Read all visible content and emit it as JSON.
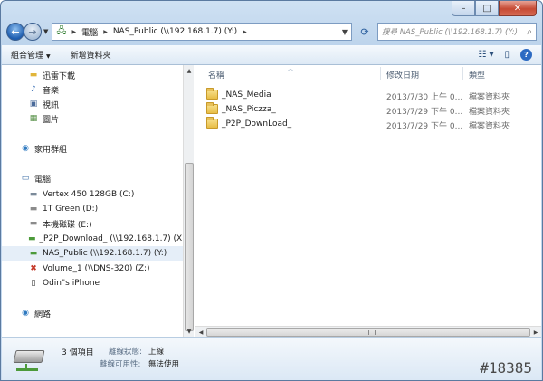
{
  "window": {
    "controls": {
      "minimize": "–",
      "maximize": "□",
      "close": "✕"
    }
  },
  "address": {
    "path": [
      "電腦",
      "NAS_Public (\\\\192.168.1.7) (Y:)"
    ],
    "search_placeholder": "搜尋 NAS_Public (\\\\192.168.1.7) (Y:)"
  },
  "toolbar": {
    "organize": "組合管理",
    "new_folder": "新增資料夾"
  },
  "nav": {
    "items": [
      {
        "label": "迅雷下載",
        "icon": "folder-icon",
        "indent": 1
      },
      {
        "label": "音樂",
        "icon": "music-icon",
        "indent": 1
      },
      {
        "label": "視訊",
        "icon": "video-icon",
        "indent": 1
      },
      {
        "label": "圖片",
        "icon": "picture-icon",
        "indent": 1
      },
      {
        "label": "家用群組",
        "icon": "homegroup-icon",
        "indent": 0
      },
      {
        "label": "電腦",
        "icon": "computer-icon",
        "indent": 0
      },
      {
        "label": "Vertex 450 128GB (C:)",
        "icon": "windows-drive-icon",
        "indent": 1
      },
      {
        "label": "1T Green (D:)",
        "icon": "drive-icon",
        "indent": 1
      },
      {
        "label": "本機磁碟 (E:)",
        "icon": "drive-icon",
        "indent": 1
      },
      {
        "label": "_P2P_Download_ (\\\\192.168.1.7) (X:)",
        "icon": "network-drive-icon",
        "indent": 1
      },
      {
        "label": "NAS_Public (\\\\192.168.1.7) (Y:)",
        "icon": "network-drive-icon",
        "indent": 1,
        "selected": true
      },
      {
        "label": "Volume_1 (\\\\DNS-320) (Z:)",
        "icon": "disconnected-drive-icon",
        "indent": 1
      },
      {
        "label": "Odin\"s iPhone",
        "icon": "phone-icon",
        "indent": 1
      },
      {
        "label": "網路",
        "icon": "network-icon",
        "indent": 0
      }
    ]
  },
  "columns": {
    "name": "名稱",
    "date": "修改日期",
    "type": "類型"
  },
  "files": [
    {
      "name": "_NAS_Media",
      "date": "2013/7/30 上午 0...",
      "type": "檔案資料夾"
    },
    {
      "name": "_NAS_Piczza_",
      "date": "2013/7/29 下午 0...",
      "type": "檔案資料夾"
    },
    {
      "name": "_P2P_DownLoad_",
      "date": "2013/7/29 下午 0...",
      "type": "檔案資料夾"
    }
  ],
  "details": {
    "count": "3 個項目",
    "status_label": "離線狀態:",
    "status_value": "上線",
    "avail_label": "離線可用性:",
    "avail_value": "無法使用"
  },
  "watermark": "#18385"
}
